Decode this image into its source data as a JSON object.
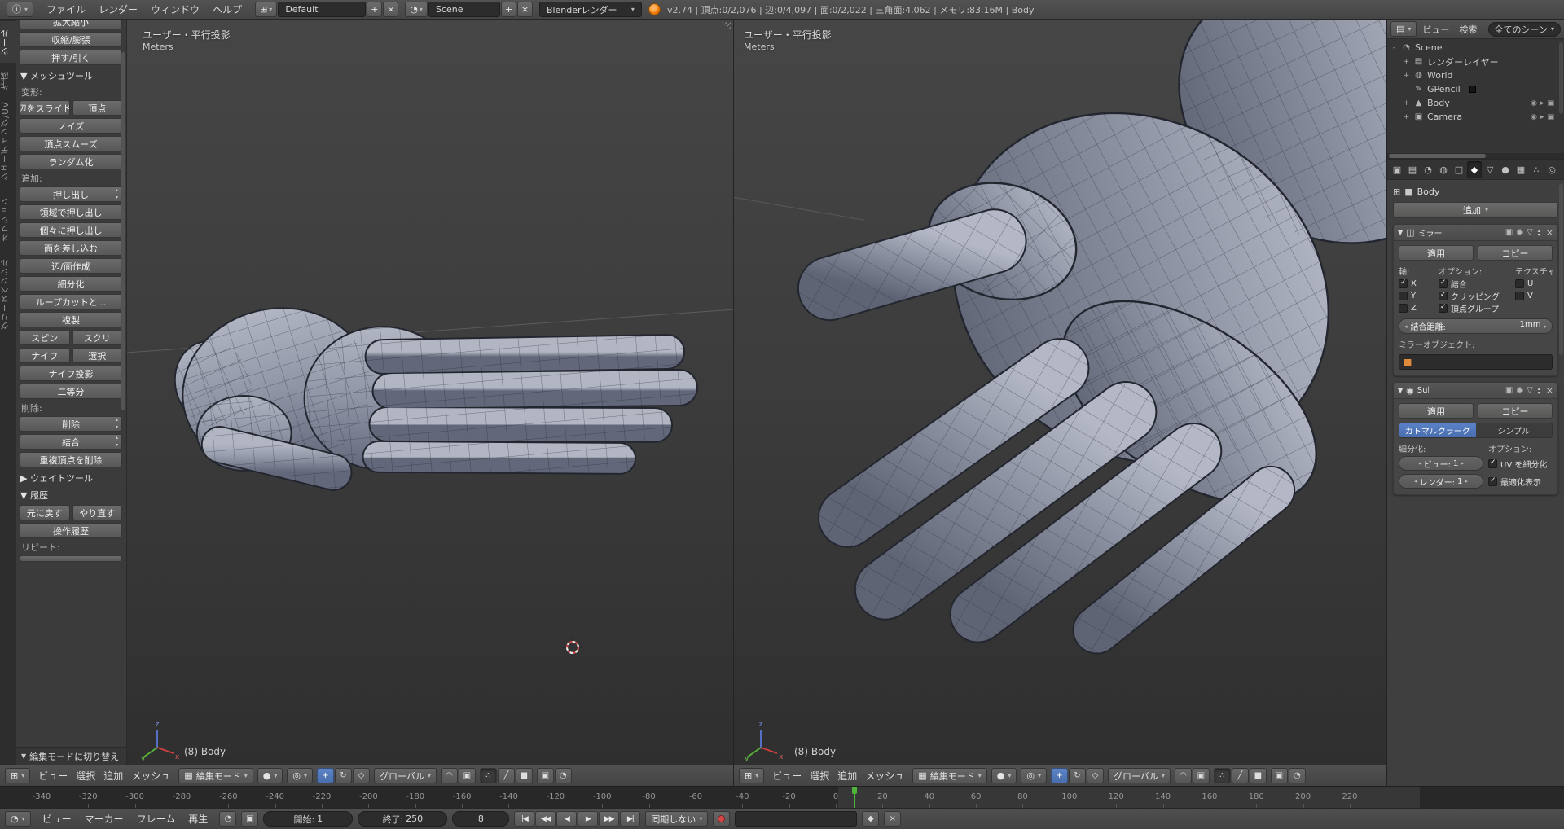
{
  "top_header": {
    "app_menus": [
      "ファイル",
      "レンダー",
      "ウィンドウ",
      "ヘルプ"
    ],
    "layout_name": "Default",
    "scene_name": "Scene",
    "engine_name": "Blenderレンダー",
    "stats": "v2.74 | 頂点:0/2,076 | 辺:0/4,097 | 面:0/2,022 | 三角面:4,062 | メモリ:83.16M | Body"
  },
  "tool_shelf": {
    "tabs": [
      {
        "label": "ツール",
        "active": true
      },
      {
        "label": "作成",
        "active": false
      },
      {
        "label": "シェーディング/UV",
        "active": false
      },
      {
        "label": "オプション",
        "active": false
      },
      {
        "label": "グリースペンシル",
        "active": false
      }
    ],
    "sections": [
      {
        "t": "btn",
        "label": "拡大縮小",
        "clipTop": true,
        "name": "tool-scale"
      },
      {
        "t": "btn",
        "label": "収縮/膨張",
        "name": "tool-shrink-fatten"
      },
      {
        "t": "btn",
        "label": "押す/引く",
        "name": "tool-push-pull"
      },
      {
        "t": "hdr",
        "label": "メッシュツール",
        "open": true
      },
      {
        "t": "lbl",
        "label": "変形:"
      },
      {
        "t": "row",
        "items": [
          {
            "label": "辺をスライド",
            "name": "tool-edge-slide"
          },
          {
            "label": "頂点",
            "name": "tool-vertex-slide"
          }
        ]
      },
      {
        "t": "btn",
        "label": "ノイズ",
        "name": "tool-noise"
      },
      {
        "t": "btn",
        "label": "頂点スムーズ",
        "name": "tool-vertex-smooth"
      },
      {
        "t": "btn",
        "label": "ランダム化",
        "name": "tool-randomize"
      },
      {
        "t": "lbl",
        "label": "追加:"
      },
      {
        "t": "btn",
        "label": "押し出し",
        "dd": true,
        "name": "tool-extrude"
      },
      {
        "t": "btn",
        "label": "領域で押し出し",
        "name": "tool-extrude-region"
      },
      {
        "t": "btn",
        "label": "個々に押し出し",
        "name": "tool-extrude-individual"
      },
      {
        "t": "btn",
        "label": "面を差し込む",
        "name": "tool-inset-faces"
      },
      {
        "t": "btn",
        "label": "辺/面作成",
        "name": "tool-make-edge-face"
      },
      {
        "t": "btn",
        "label": "細分化",
        "name": "tool-subdivide"
      },
      {
        "t": "btn",
        "label": "ループカットと...",
        "name": "tool-loop-cut"
      },
      {
        "t": "btn",
        "label": "複製",
        "name": "tool-duplicate"
      },
      {
        "t": "row",
        "items": [
          {
            "label": "スピン",
            "name": "tool-spin"
          },
          {
            "label": "スクリ",
            "name": "tool-screw"
          }
        ]
      },
      {
        "t": "row",
        "items": [
          {
            "label": "ナイフ",
            "name": "tool-knife"
          },
          {
            "label": "選択",
            "name": "tool-knife-select"
          }
        ]
      },
      {
        "t": "btn",
        "label": "ナイフ投影",
        "name": "tool-knife-project"
      },
      {
        "t": "btn",
        "label": "二等分",
        "name": "tool-bisect"
      },
      {
        "t": "lbl",
        "label": "削除:"
      },
      {
        "t": "btn",
        "label": "削除",
        "dd": true,
        "name": "tool-delete"
      },
      {
        "t": "btn",
        "label": "結合",
        "dd": true,
        "name": "tool-merge"
      },
      {
        "t": "btn",
        "label": "重複頂点を削除",
        "name": "tool-remove-doubles"
      },
      {
        "t": "hdr",
        "label": "ウェイトツール",
        "open": false
      },
      {
        "t": "hdr",
        "label": "履歴",
        "open": true
      },
      {
        "t": "row",
        "items": [
          {
            "label": "元に戻す",
            "name": "tool-undo"
          },
          {
            "label": "やり直す",
            "name": "tool-redo"
          }
        ]
      },
      {
        "t": "btn",
        "label": "操作履歴",
        "name": "tool-undo-history"
      },
      {
        "t": "lbl",
        "label": "リピート:"
      },
      {
        "t": "btn",
        "label": "",
        "clipBottom": true,
        "name": "tool-repeat-last"
      }
    ],
    "operator_panel": "編集モードに切り替え"
  },
  "viewport": {
    "overlay_title": "ユーザー・平行投影",
    "overlay_unit": "Meters",
    "object_label": "(8) Body",
    "menus": [
      "ビュー",
      "選択",
      "追加",
      "メッシュ"
    ],
    "mode": "編集モード",
    "orientation": "グローバル"
  },
  "outliner": {
    "view_menu": "ビュー",
    "search_menu": "検索",
    "filter": "全てのシーン",
    "items": [
      {
        "label": "Scene",
        "depth": 0,
        "exp": "-",
        "icon": "scene",
        "glyph": "◔"
      },
      {
        "label": "レンダーレイヤー",
        "depth": 1,
        "exp": "+",
        "icon": "render-layers",
        "glyph": "▤"
      },
      {
        "label": "World",
        "depth": 1,
        "exp": "+",
        "icon": "world",
        "glyph": "◍"
      },
      {
        "label": "GPencil",
        "depth": 1,
        "exp": "",
        "icon": "gpencil",
        "glyph": "✎",
        "swatch": true
      },
      {
        "label": "Body",
        "depth": 1,
        "exp": "+",
        "icon": "mesh",
        "glyph": "▲",
        "toggles": true
      },
      {
        "label": "Camera",
        "depth": 1,
        "exp": "+",
        "icon": "camera",
        "glyph": "▣",
        "toggles": true
      }
    ]
  },
  "properties": {
    "tabs": [
      {
        "name": "render",
        "glyph": "▣",
        "active": false
      },
      {
        "name": "render-layers",
        "glyph": "▤",
        "active": false
      },
      {
        "name": "scene",
        "glyph": "◔",
        "active": false
      },
      {
        "name": "world",
        "glyph": "◍",
        "active": false
      },
      {
        "name": "object",
        "glyph": "□",
        "active": false
      },
      {
        "name": "modifiers",
        "glyph": "◆",
        "active": true
      },
      {
        "name": "object-data",
        "glyph": "▽",
        "active": false
      },
      {
        "name": "material",
        "glyph": "●",
        "active": false
      },
      {
        "name": "texture",
        "glyph": "▦",
        "active": false
      },
      {
        "name": "particles",
        "glyph": "∴",
        "active": false
      },
      {
        "name": "physics",
        "glyph": "◎",
        "active": false
      }
    ],
    "object_name": "Body",
    "add_modifier": "追加",
    "mirror": {
      "name": "ミラー",
      "apply": "適用",
      "copy": "コピー",
      "axis_label": "軸:",
      "options_label": "オプション:",
      "textures_label": "テクスチャ:",
      "checks_col1": [
        {
          "label": "X",
          "on": true
        },
        {
          "label": "Y",
          "on": false
        },
        {
          "label": "Z",
          "on": false
        }
      ],
      "checks_col2": [
        {
          "label": "結合",
          "on": true
        },
        {
          "label": "クリッピング",
          "on": true
        },
        {
          "label": "頂点グループ",
          "on": true
        }
      ],
      "checks_col3": [
        {
          "label": "U",
          "on": false
        },
        {
          "label": "V",
          "on": false
        }
      ],
      "merge_label": "結合距離:",
      "merge_value": "1mm",
      "mirror_object_label": "ミラーオブジェクト:"
    },
    "subsurf": {
      "name": "Subsurf",
      "apply": "適用",
      "copy": "コピー",
      "catmull": "カトマルクラーク",
      "simple": "シンプル",
      "subdivisions_label": "細分化:",
      "options_label": "オプション:",
      "view_label": "ビュー:",
      "view_value": "1",
      "render_label": "レンダー:",
      "render_value": "1",
      "uv_label": "UV を細分化",
      "uv_on": true,
      "optimal_label": "最適化表示",
      "optimal_on": true
    }
  },
  "timeline": {
    "menus": [
      "ビュー",
      "マーカー",
      "フレーム",
      "再生"
    ],
    "start_label": "開始:",
    "start_value": "1",
    "end_label": "終了:",
    "end_value": "250",
    "frame_value": "8",
    "sync": "同期しない",
    "playback": [
      {
        "name": "jump-to-start",
        "g": "|◀"
      },
      {
        "name": "prev-keyframe",
        "g": "◀◀"
      },
      {
        "name": "play-reverse",
        "g": "◀"
      },
      {
        "name": "play",
        "g": "▶"
      },
      {
        "name": "next-keyframe",
        "g": "▶▶"
      },
      {
        "name": "jump-to-end",
        "g": "▶|"
      }
    ],
    "tick_frames": [
      -340,
      -320,
      -300,
      -280,
      -260,
      -240,
      -220,
      -200,
      -180,
      -160,
      -140,
      -120,
      -100,
      -80,
      -60,
      -40,
      -20,
      0,
      20,
      40,
      60,
      80,
      100,
      120,
      140,
      160,
      180,
      200,
      220
    ],
    "current_frame": 8,
    "range": {
      "start": 1,
      "end": 250
    }
  },
  "colors": {
    "accent": "#5680c2",
    "playhead": "#4eb53a",
    "record": "#d24848",
    "mesh_light": "#b2b6c3",
    "mesh_dark": "#62677a"
  }
}
